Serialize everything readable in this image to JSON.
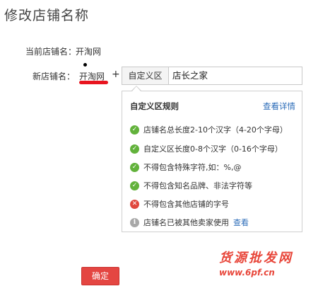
{
  "page": {
    "title": "修改店铺名称"
  },
  "current_name": {
    "label": "当前店铺名：",
    "value": "开淘网"
  },
  "new_name": {
    "label": "新店铺名：",
    "fixed_value": "开淘网",
    "plus": "+",
    "prefix_label": "自定义区",
    "input_value": "店长之家"
  },
  "rules_panel": {
    "title": "自定义区规则",
    "details_link": "查看详情",
    "rules": [
      {
        "status": "ok",
        "icon": "check-icon",
        "text": "店铺名总长度2-10个汉字（4-20个字母）"
      },
      {
        "status": "ok",
        "icon": "check-icon",
        "text": "自定义区长度0-8个汉字（0-16个字母）"
      },
      {
        "status": "ok",
        "icon": "check-icon",
        "text": "不得包含特殊字符,如：%,@"
      },
      {
        "status": "ok",
        "icon": "check-icon",
        "text": "不得包含知名品牌、非法字符等"
      },
      {
        "status": "error",
        "icon": "cross-icon",
        "text": "不得包含其他店铺的字号"
      },
      {
        "status": "info",
        "icon": "info-icon",
        "text": "店铺名已被其他卖家使用",
        "link": "查看"
      }
    ]
  },
  "confirm_button": {
    "label": "确定"
  },
  "watermark": {
    "main": "货源批发网",
    "url": "www.6pf.cn"
  },
  "colors": {
    "accent_red": "#e8141f",
    "button_red": "#e44642",
    "link_blue": "#2c6cb8",
    "ok_green": "#62b23b",
    "error_red": "#e0483e",
    "info_gray": "#a8a8a8"
  }
}
